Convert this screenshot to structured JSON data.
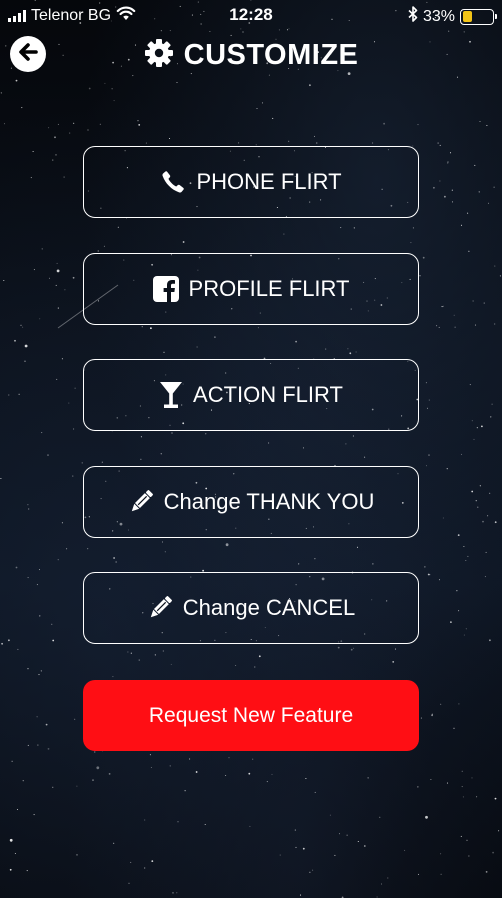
{
  "status_bar": {
    "carrier": "Telenor BG",
    "time": "12:28",
    "battery_percent": "33%",
    "battery_level": 0.33,
    "battery_color": "#f2c417"
  },
  "header": {
    "title": "CUSTOMIZE",
    "back_icon": "arrow-left-circle-icon",
    "title_icon": "gear-icon"
  },
  "menu": [
    {
      "label": "PHONE FLIRT",
      "icon": "phone-icon"
    },
    {
      "label": "PROFILE FLIRT",
      "icon": "facebook-icon"
    },
    {
      "label": "ACTION FLIRT",
      "icon": "cocktail-glass-icon"
    },
    {
      "label": "Change THANK YOU",
      "icon": "pencil-icon"
    },
    {
      "label": "Change CANCEL",
      "icon": "pencil-icon"
    }
  ],
  "request_button": {
    "label": "Request New Feature",
    "color": "#ff0e14"
  }
}
